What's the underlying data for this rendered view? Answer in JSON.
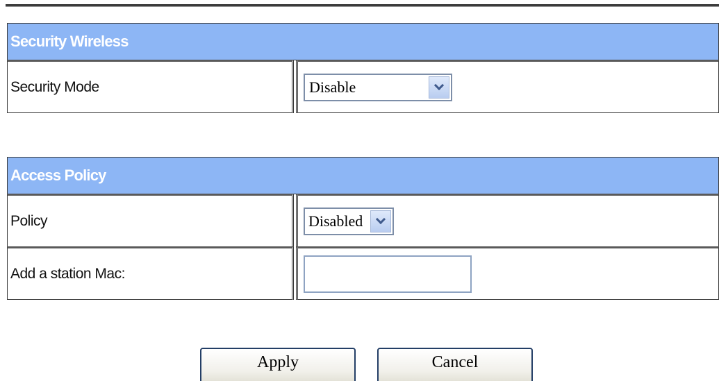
{
  "security_wireless": {
    "header": "Security Wireless",
    "mode_label": "Security Mode",
    "mode_value": "Disable"
  },
  "access_policy": {
    "header": "Access Policy",
    "policy_label": "Policy",
    "policy_value": "Disabled",
    "mac_label": "Add a station Mac:",
    "mac_value": ""
  },
  "buttons": {
    "apply": "Apply",
    "cancel": "Cancel"
  },
  "icons": {
    "dropdown_arrow": "chevron-down-icon"
  },
  "colors": {
    "header_bg": "#8db6f5",
    "header_text": "#ffffff",
    "border": "#3a3a3a"
  }
}
